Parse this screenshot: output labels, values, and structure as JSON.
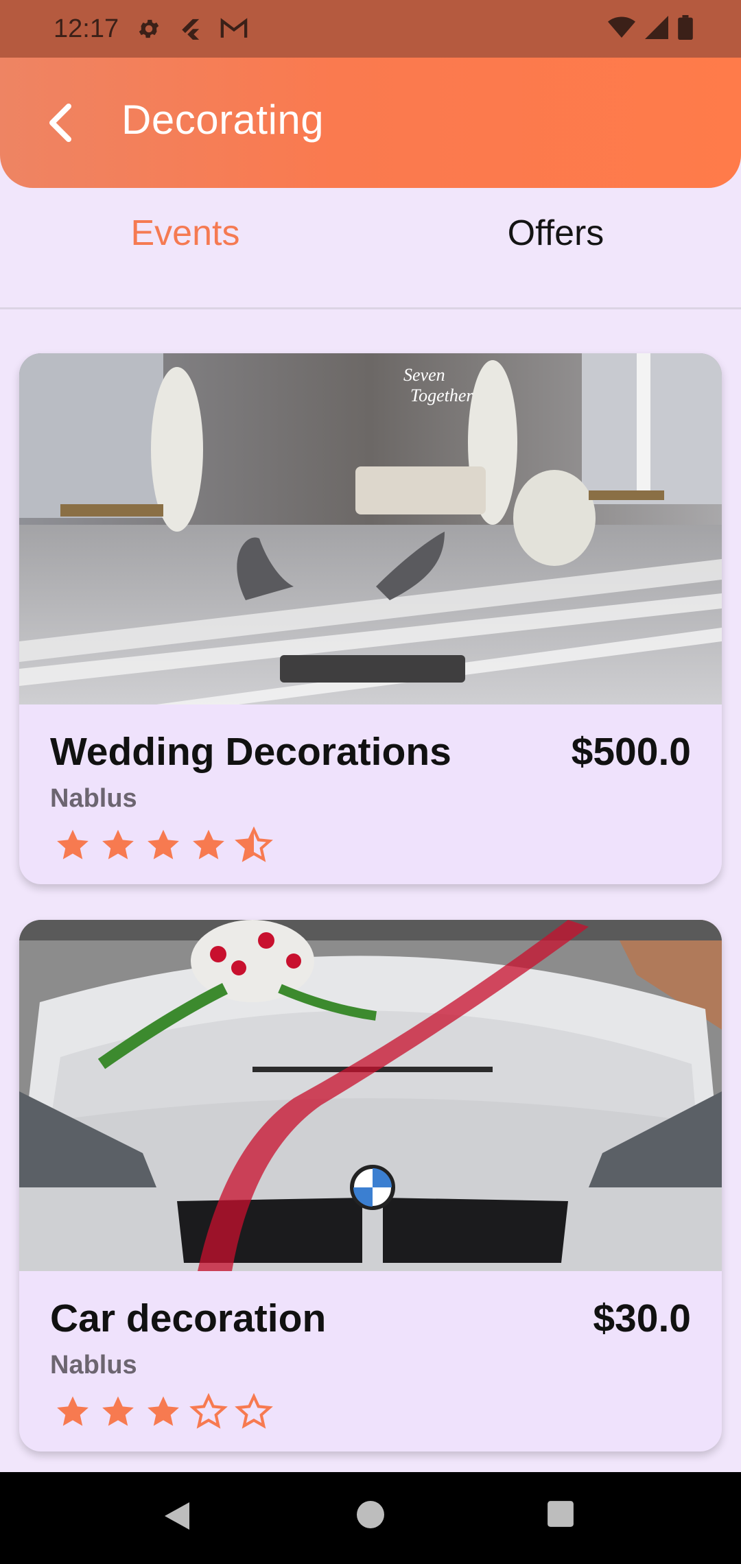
{
  "status_bar": {
    "time": "12:17",
    "icons": [
      "gear-icon",
      "flutter-icon",
      "gmail-icon",
      "wifi-icon",
      "signal-icon",
      "battery-icon"
    ]
  },
  "app_bar": {
    "title": "Decorating",
    "back_icon": "chevron-left-icon"
  },
  "tabs": [
    {
      "label": "Events",
      "active": true
    },
    {
      "label": "Offers",
      "active": false
    }
  ],
  "cards": [
    {
      "title": "Wedding Decorations",
      "price": "$500.0",
      "location": "Nablus",
      "rating": 4.5,
      "image": "wedding-stage-photo"
    },
    {
      "title": "Car decoration",
      "price": "$30.0",
      "location": "Nablus",
      "rating": 3,
      "image": "decorated-car-photo"
    }
  ],
  "colors": {
    "accent": "#f77a50",
    "app_bar": "#ff7b4a",
    "background": "#f1e6fb",
    "card": "#efe2fc",
    "status_bar": "#b55a3f"
  },
  "nav_bar": {
    "icons": [
      "back-triangle-icon",
      "home-circle-icon",
      "recents-square-icon"
    ]
  }
}
